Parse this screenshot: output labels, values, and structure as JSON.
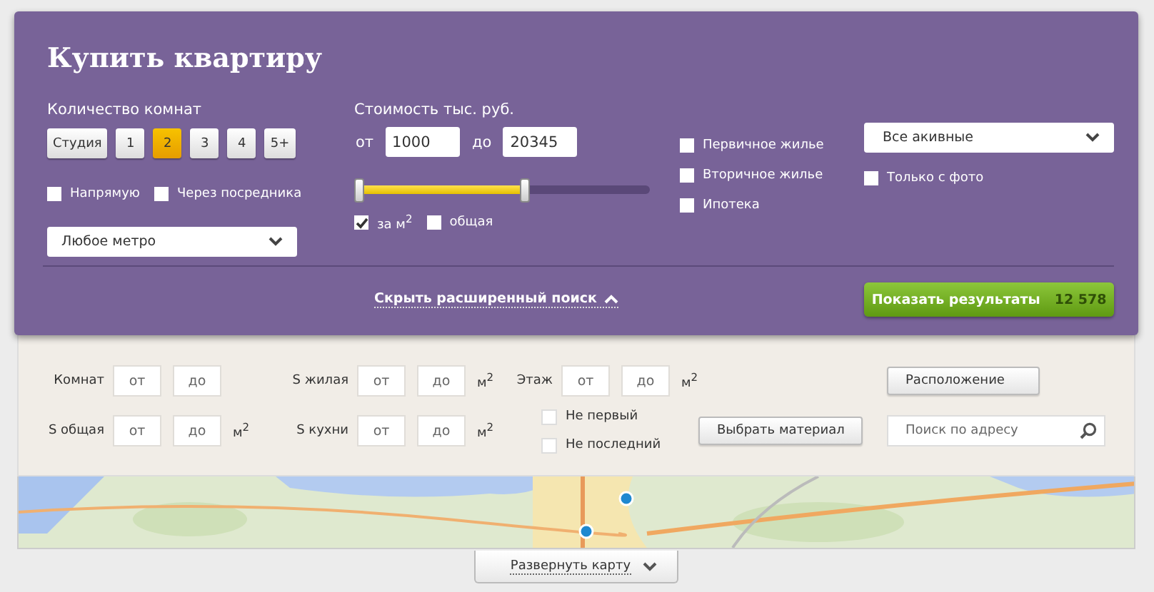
{
  "title": "Купить квартиру",
  "rooms": {
    "label": "Количество комнат",
    "options": [
      {
        "label": "Студия",
        "selected": false
      },
      {
        "label": "1",
        "selected": false
      },
      {
        "label": "2",
        "selected": true
      },
      {
        "label": "3",
        "selected": false
      },
      {
        "label": "4",
        "selected": false
      },
      {
        "label": "5+",
        "selected": false
      }
    ]
  },
  "seller": [
    {
      "label": "Напрямую",
      "checked": false
    },
    {
      "label": "Через посредника",
      "checked": false
    }
  ],
  "metro": {
    "value": "Любое метро"
  },
  "price": {
    "label": "Стоимость тыс. руб.",
    "from_label": "от",
    "from_value": "1000",
    "to_label": "до",
    "to_value": "20345",
    "slider": {
      "level": 0.57
    },
    "units": [
      {
        "label": "за м$^{2}$",
        "checked": true
      },
      {
        "label": "общая",
        "checked": false
      }
    ]
  },
  "types": [
    {
      "label": "Первичное жилье",
      "checked": false
    },
    {
      "label": "Вторичное жилье",
      "checked": false
    },
    {
      "label": "Ипотека",
      "checked": false
    }
  ],
  "status": {
    "value": "Все акивные"
  },
  "photo_only": {
    "label": "Только с фото",
    "checked": false
  },
  "toggle_link": "Скрыть расширенный поиск",
  "show_button": {
    "label": "Показать результаты",
    "count": "12 578"
  },
  "advanced": {
    "columns": [
      [
        {
          "kind": "range",
          "label": "Комнат",
          "from_placeholder": "от",
          "to_placeholder": "до"
        },
        {
          "kind": "range",
          "label": "S общая",
          "from_placeholder": "от",
          "to_placeholder": "до",
          "unit": "м$^{2}$"
        }
      ],
      [
        {
          "kind": "range",
          "label": "S жилая",
          "from_placeholder": "от",
          "to_placeholder": "до",
          "unit": "м$^{2}$"
        },
        {
          "kind": "range",
          "label": "S кухни",
          "from_placeholder": "от",
          "to_placeholder": "до",
          "unit": "м$^{2}$"
        }
      ],
      [
        {
          "kind": "range",
          "label": "Этаж",
          "from_placeholder": "от",
          "to_placeholder": "до",
          "unit": "м$^{2}$"
        },
        {
          "kind": "checks",
          "items": [
            {
              "label": "Не первый",
              "checked": false
            },
            {
              "label": "Не последний",
              "checked": false
            }
          ]
        }
      ],
      [
        {
          "kind": "button",
          "label": "Выбрать материал"
        }
      ],
      [
        {
          "kind": "button",
          "label": "Расположение"
        },
        {
          "kind": "search",
          "placeholder": "Поиск по адресу"
        }
      ]
    ]
  },
  "map": {
    "kind": "picture",
    "expand_label": "Развернуть карту"
  }
}
